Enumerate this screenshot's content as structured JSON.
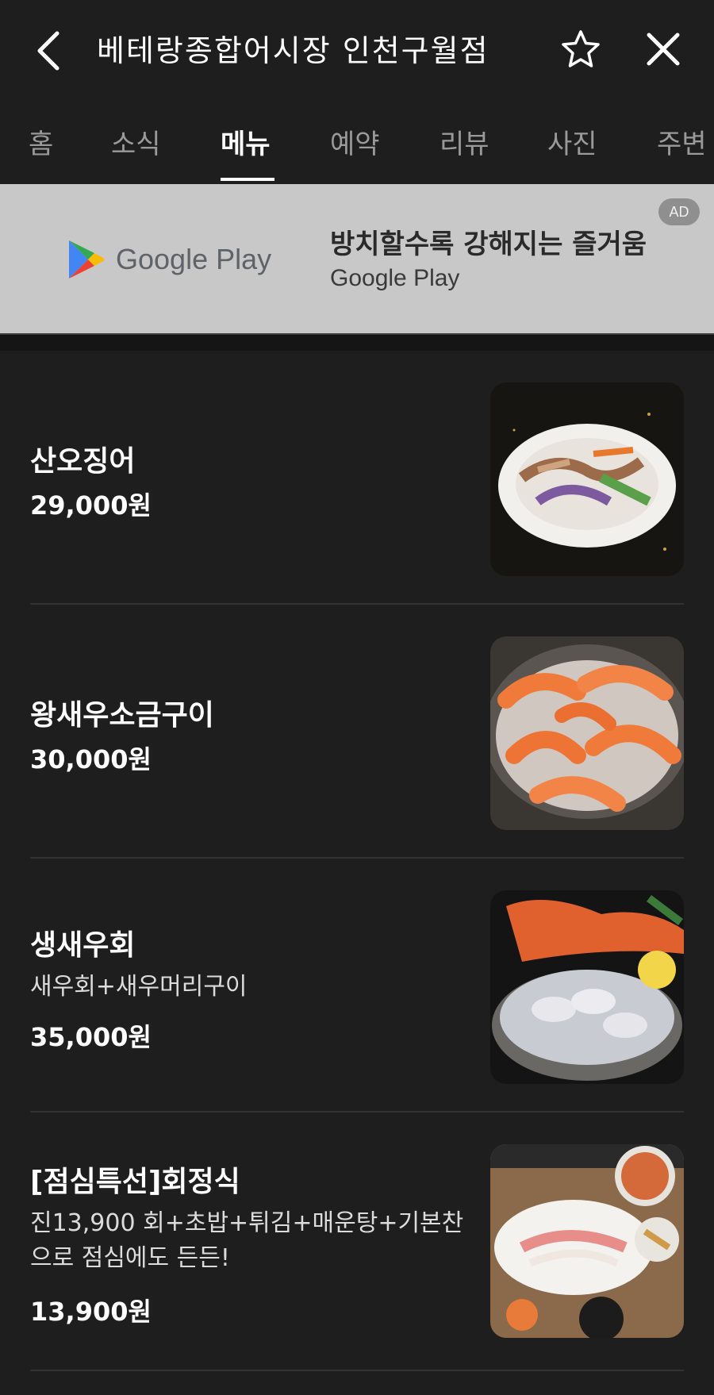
{
  "header": {
    "title": "베테랑종합어시장 인천구월점"
  },
  "tabs": [
    "홈",
    "소식",
    "메뉴",
    "예약",
    "리뷰",
    "사진",
    "주변"
  ],
  "active_tab": "메뉴",
  "ad": {
    "badge": "AD",
    "logo_text": "Google Play",
    "title": "방치할수록 강해지는 즐거움",
    "subtitle": "Google Play"
  },
  "menu": [
    {
      "name": "산오징어",
      "description": "",
      "price": "29,000원",
      "image": "squid-salad-dish"
    },
    {
      "name": "왕새우소금구이",
      "description": "",
      "price": "30,000원",
      "image": "salt-grilled-prawns"
    },
    {
      "name": "생새우회",
      "description": "새우회+새우머리구이",
      "price": "35,000원",
      "image": "raw-shrimp-platter"
    },
    {
      "name": "[점심특선]회정식",
      "description": "진13,900 회+초밥+튀김+매운탕+기본찬으로 점심에도 든든!",
      "price": "13,900원",
      "image": "lunch-sashimi-set"
    }
  ]
}
